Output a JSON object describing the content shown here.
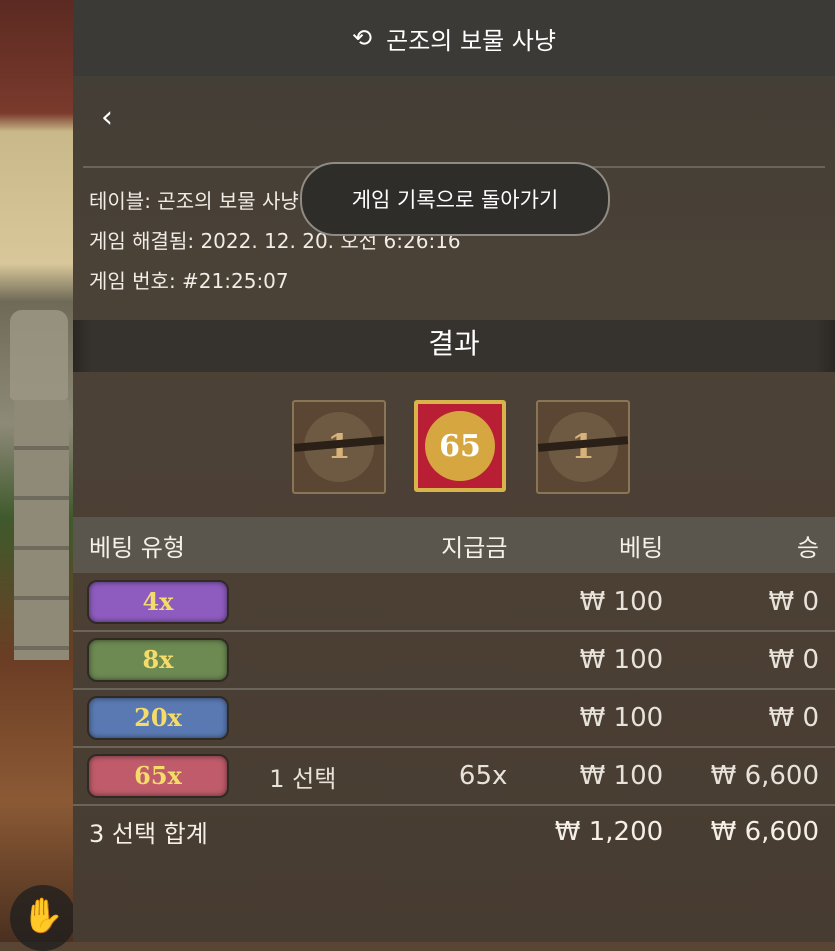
{
  "panel": {
    "title": "곤조의 보물 사냥",
    "back_button": "게임 기록으로 돌아가기"
  },
  "info": {
    "table": "테이블: 곤조의 보물 사냥",
    "resolved": "게임 해결됨: 2022. 12. 20. 오전 6:26:16",
    "game_number": "게임 번호: #21:25:07"
  },
  "result": {
    "heading": "결과",
    "tiles": [
      "1",
      "65",
      "1"
    ]
  },
  "bets": {
    "headers": {
      "type": "베팅 유형",
      "payout": "지급금",
      "bet": "베팅",
      "win": "승"
    },
    "rows": [
      {
        "badge": "4x",
        "selection": "",
        "payout": "",
        "bet": "₩ 100",
        "win": "₩ 0"
      },
      {
        "badge": "8x",
        "selection": "",
        "payout": "",
        "bet": "₩ 100",
        "win": "₩ 0"
      },
      {
        "badge": "20x",
        "selection": "",
        "payout": "",
        "bet": "₩ 100",
        "win": "₩ 0"
      },
      {
        "badge": "65x",
        "selection": "1 선택",
        "payout": "65x",
        "bet": "₩ 100",
        "win": "₩ 6,600"
      }
    ],
    "total": {
      "label": "3 선택 합계",
      "bet": "₩ 1,200",
      "win": "₩ 6,600"
    }
  }
}
